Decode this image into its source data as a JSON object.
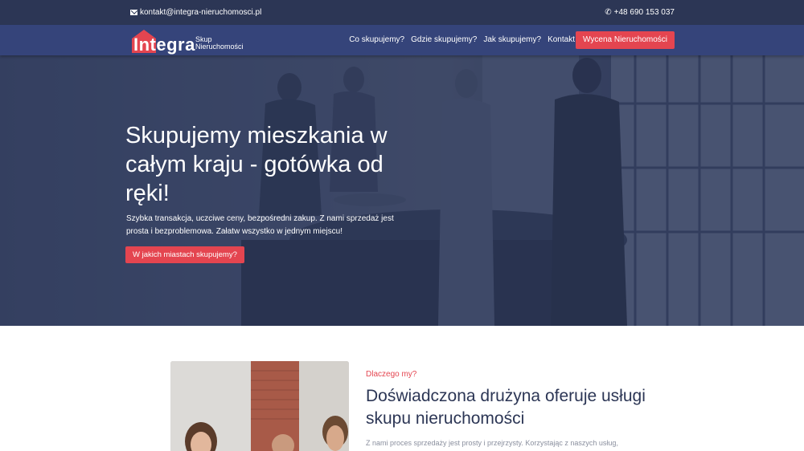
{
  "topbar": {
    "email": "kontakt@integra-nieruchomosci.pl",
    "phone": "+48 690 153 037",
    "email_icon": "envelope-icon",
    "phone_icon": "phone-icon"
  },
  "nav": {
    "logo_text": "Integra",
    "logo_sub_1": "Skup",
    "logo_sub_2": "Nieruchomości",
    "links": [
      "Co skupujemy?",
      "Gdzie skupujemy?",
      "Jak skupujemy?",
      "Kontakt"
    ],
    "cta": "Wycena Nieruchomości"
  },
  "hero": {
    "title": "Skupujemy mieszkania w całym kraju - gotówka od ręki!",
    "text": "Szybka transakcja, uczciwe ceny, bezpośredni zakup. Z nami sprzedaż jest prosta i bezproblemowa. Załatw wszystko w jednym miejscu!",
    "button": "W jakich miastach skupujemy?"
  },
  "about": {
    "eyebrow": "Dlaczego my?",
    "title": "Doświadczona drużyna oferuje usługi skupu nieruchomości",
    "text": "Z nami proces sprzedaży jest prosty i przejrzysty. Korzystając z naszych usług,"
  },
  "colors": {
    "topbar": "#2c3655",
    "navbar": "#35447a",
    "accent": "#e44550",
    "heading": "#2c3655"
  }
}
